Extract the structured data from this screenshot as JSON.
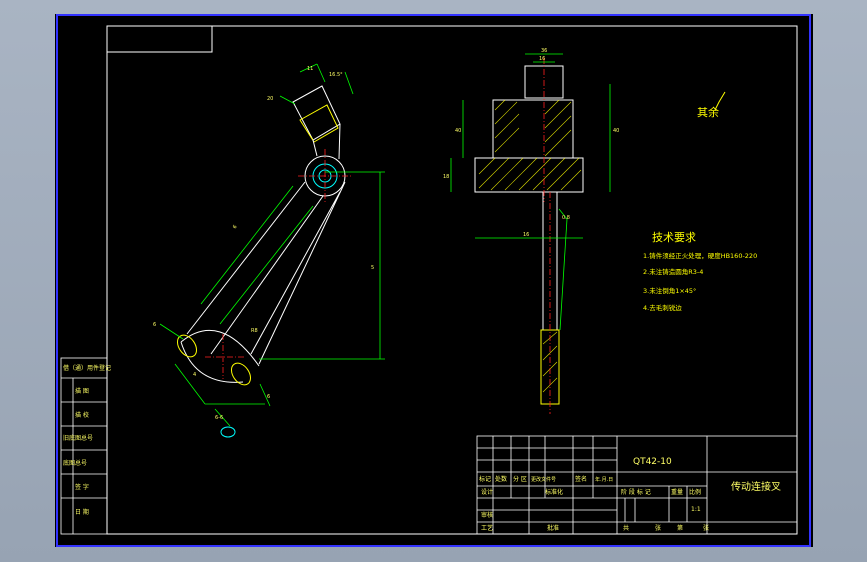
{
  "colors": {
    "border": "#3333ff",
    "outline": "#ffffff",
    "dimension": "#00ff00",
    "center": "#ff2020",
    "hatch": "#ffff00",
    "note": "#ffff00",
    "title_block": "#ffffff",
    "text": "#ffff66"
  },
  "left_view": {
    "dims": {
      "d_top": "11",
      "d_angle": "16.5°",
      "d_side": "20",
      "d_arm": "6",
      "d_height": "5",
      "d_bottom": "6",
      "d_bottom2": "4",
      "d_rad": "R8",
      "d_small": "6",
      "section_mark": "6-6"
    }
  },
  "right_view": {
    "dims": {
      "w_top": "36",
      "w_inner": "16",
      "h_left": "40",
      "h_right": "40",
      "h_base": "18",
      "w_base": "16",
      "h_rod": "0.8"
    }
  },
  "notes": {
    "scribble": "其余",
    "title": "技术要求",
    "items": [
      "1.铸件须经正火处理，硬度HB160-220",
      "2.未注铸造圆角R3-4",
      "3.未注倒角1×45°",
      "4.去毛刺锐边"
    ]
  },
  "sidebar": {
    "rows": [
      "借（通）用件登记",
      "描 图",
      "描 校",
      "旧底图总号",
      "底图总号",
      "签 字",
      "日 期"
    ]
  },
  "title_block": {
    "drawing_no": "QT42-10",
    "part_name": "传动连接叉",
    "row_mark": [
      "标记",
      "处数",
      "分 区",
      "更改文件号",
      "签名",
      "年.月.日"
    ],
    "row_design": [
      "设计",
      "",
      "标准化"
    ],
    "stage": [
      "阶 段 标 记",
      "重量",
      "比例"
    ],
    "scale": "1:1",
    "row_audit": [
      "审核"
    ],
    "row_process": [
      "工艺",
      "",
      "批准"
    ],
    "sheets": [
      "共",
      "张",
      "第",
      "张"
    ]
  }
}
